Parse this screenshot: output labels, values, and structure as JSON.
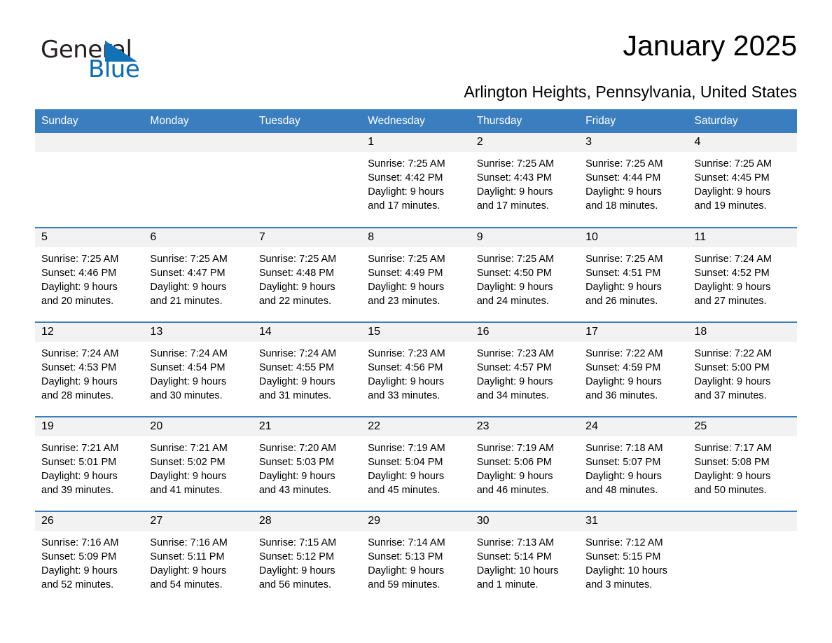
{
  "logo": {
    "word_general": "General",
    "word_blue": "Blue",
    "triangle_color": "#1272b8",
    "blue_text_color": "#0b6cb4"
  },
  "header": {
    "title": "January 2025",
    "subtitle": "Arlington Heights, Pennsylvania, United States",
    "header_bg_color": "#3a7ebf",
    "daynum_bg_color": "#f2f2f2"
  },
  "calendar": {
    "weekday_headers": [
      "Sunday",
      "Monday",
      "Tuesday",
      "Wednesday",
      "Thursday",
      "Friday",
      "Saturday"
    ],
    "weeks": [
      [
        {
          "day": "",
          "lines": []
        },
        {
          "day": "",
          "lines": []
        },
        {
          "day": "",
          "lines": []
        },
        {
          "day": "1",
          "lines": [
            "Sunrise: 7:25 AM",
            "Sunset: 4:42 PM",
            "Daylight: 9 hours",
            "and 17 minutes."
          ]
        },
        {
          "day": "2",
          "lines": [
            "Sunrise: 7:25 AM",
            "Sunset: 4:43 PM",
            "Daylight: 9 hours",
            "and 17 minutes."
          ]
        },
        {
          "day": "3",
          "lines": [
            "Sunrise: 7:25 AM",
            "Sunset: 4:44 PM",
            "Daylight: 9 hours",
            "and 18 minutes."
          ]
        },
        {
          "day": "4",
          "lines": [
            "Sunrise: 7:25 AM",
            "Sunset: 4:45 PM",
            "Daylight: 9 hours",
            "and 19 minutes."
          ]
        }
      ],
      [
        {
          "day": "5",
          "lines": [
            "Sunrise: 7:25 AM",
            "Sunset: 4:46 PM",
            "Daylight: 9 hours",
            "and 20 minutes."
          ]
        },
        {
          "day": "6",
          "lines": [
            "Sunrise: 7:25 AM",
            "Sunset: 4:47 PM",
            "Daylight: 9 hours",
            "and 21 minutes."
          ]
        },
        {
          "day": "7",
          "lines": [
            "Sunrise: 7:25 AM",
            "Sunset: 4:48 PM",
            "Daylight: 9 hours",
            "and 22 minutes."
          ]
        },
        {
          "day": "8",
          "lines": [
            "Sunrise: 7:25 AM",
            "Sunset: 4:49 PM",
            "Daylight: 9 hours",
            "and 23 minutes."
          ]
        },
        {
          "day": "9",
          "lines": [
            "Sunrise: 7:25 AM",
            "Sunset: 4:50 PM",
            "Daylight: 9 hours",
            "and 24 minutes."
          ]
        },
        {
          "day": "10",
          "lines": [
            "Sunrise: 7:25 AM",
            "Sunset: 4:51 PM",
            "Daylight: 9 hours",
            "and 26 minutes."
          ]
        },
        {
          "day": "11",
          "lines": [
            "Sunrise: 7:24 AM",
            "Sunset: 4:52 PM",
            "Daylight: 9 hours",
            "and 27 minutes."
          ]
        }
      ],
      [
        {
          "day": "12",
          "lines": [
            "Sunrise: 7:24 AM",
            "Sunset: 4:53 PM",
            "Daylight: 9 hours",
            "and 28 minutes."
          ]
        },
        {
          "day": "13",
          "lines": [
            "Sunrise: 7:24 AM",
            "Sunset: 4:54 PM",
            "Daylight: 9 hours",
            "and 30 minutes."
          ]
        },
        {
          "day": "14",
          "lines": [
            "Sunrise: 7:24 AM",
            "Sunset: 4:55 PM",
            "Daylight: 9 hours",
            "and 31 minutes."
          ]
        },
        {
          "day": "15",
          "lines": [
            "Sunrise: 7:23 AM",
            "Sunset: 4:56 PM",
            "Daylight: 9 hours",
            "and 33 minutes."
          ]
        },
        {
          "day": "16",
          "lines": [
            "Sunrise: 7:23 AM",
            "Sunset: 4:57 PM",
            "Daylight: 9 hours",
            "and 34 minutes."
          ]
        },
        {
          "day": "17",
          "lines": [
            "Sunrise: 7:22 AM",
            "Sunset: 4:59 PM",
            "Daylight: 9 hours",
            "and 36 minutes."
          ]
        },
        {
          "day": "18",
          "lines": [
            "Sunrise: 7:22 AM",
            "Sunset: 5:00 PM",
            "Daylight: 9 hours",
            "and 37 minutes."
          ]
        }
      ],
      [
        {
          "day": "19",
          "lines": [
            "Sunrise: 7:21 AM",
            "Sunset: 5:01 PM",
            "Daylight: 9 hours",
            "and 39 minutes."
          ]
        },
        {
          "day": "20",
          "lines": [
            "Sunrise: 7:21 AM",
            "Sunset: 5:02 PM",
            "Daylight: 9 hours",
            "and 41 minutes."
          ]
        },
        {
          "day": "21",
          "lines": [
            "Sunrise: 7:20 AM",
            "Sunset: 5:03 PM",
            "Daylight: 9 hours",
            "and 43 minutes."
          ]
        },
        {
          "day": "22",
          "lines": [
            "Sunrise: 7:19 AM",
            "Sunset: 5:04 PM",
            "Daylight: 9 hours",
            "and 45 minutes."
          ]
        },
        {
          "day": "23",
          "lines": [
            "Sunrise: 7:19 AM",
            "Sunset: 5:06 PM",
            "Daylight: 9 hours",
            "and 46 minutes."
          ]
        },
        {
          "day": "24",
          "lines": [
            "Sunrise: 7:18 AM",
            "Sunset: 5:07 PM",
            "Daylight: 9 hours",
            "and 48 minutes."
          ]
        },
        {
          "day": "25",
          "lines": [
            "Sunrise: 7:17 AM",
            "Sunset: 5:08 PM",
            "Daylight: 9 hours",
            "and 50 minutes."
          ]
        }
      ],
      [
        {
          "day": "26",
          "lines": [
            "Sunrise: 7:16 AM",
            "Sunset: 5:09 PM",
            "Daylight: 9 hours",
            "and 52 minutes."
          ]
        },
        {
          "day": "27",
          "lines": [
            "Sunrise: 7:16 AM",
            "Sunset: 5:11 PM",
            "Daylight: 9 hours",
            "and 54 minutes."
          ]
        },
        {
          "day": "28",
          "lines": [
            "Sunrise: 7:15 AM",
            "Sunset: 5:12 PM",
            "Daylight: 9 hours",
            "and 56 minutes."
          ]
        },
        {
          "day": "29",
          "lines": [
            "Sunrise: 7:14 AM",
            "Sunset: 5:13 PM",
            "Daylight: 9 hours",
            "and 59 minutes."
          ]
        },
        {
          "day": "30",
          "lines": [
            "Sunrise: 7:13 AM",
            "Sunset: 5:14 PM",
            "Daylight: 10 hours",
            "and 1 minute."
          ]
        },
        {
          "day": "31",
          "lines": [
            "Sunrise: 7:12 AM",
            "Sunset: 5:15 PM",
            "Daylight: 10 hours",
            "and 3 minutes."
          ]
        },
        {
          "day": "",
          "lines": []
        }
      ]
    ]
  }
}
